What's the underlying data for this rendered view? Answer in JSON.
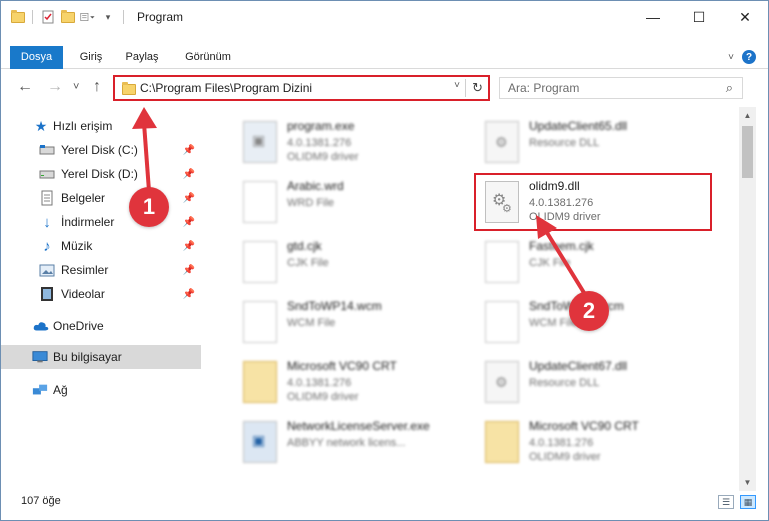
{
  "window": {
    "title": "Program",
    "minimize": "—",
    "maximize": "☐",
    "close": "✕"
  },
  "ribbon": {
    "tabs": [
      "Dosya",
      "Giriş",
      "Paylaş",
      "Görünüm"
    ],
    "help_label": "?"
  },
  "navigation": {
    "back": "←",
    "forward": "→",
    "recent": "˅",
    "up": "↑",
    "address_path": "C:\\Program Files\\Program Dizini",
    "search_placeholder": "Ara: Program"
  },
  "sidebar": {
    "items": [
      {
        "label": "Hızlı erişim",
        "icon": "star-icon"
      },
      {
        "label": "Yerel Disk (C:)",
        "icon": "drive-icon",
        "pinned": true
      },
      {
        "label": "Yerel Disk (D:)",
        "icon": "drive-icon",
        "pinned": true
      },
      {
        "label": "Belgeler",
        "icon": "documents-icon",
        "pinned": true
      },
      {
        "label": "İndirmeler",
        "icon": "downloads-icon",
        "pinned": true
      },
      {
        "label": "Müzik",
        "icon": "music-icon",
        "pinned": true
      },
      {
        "label": "Resimler",
        "icon": "pictures-icon",
        "pinned": true
      },
      {
        "label": "Videolar",
        "icon": "videos-icon",
        "pinned": true
      },
      {
        "label": "OneDrive",
        "icon": "cloud-icon"
      },
      {
        "label": "Bu bilgisayar",
        "icon": "computer-icon"
      },
      {
        "label": "Ağ",
        "icon": "network-icon"
      }
    ]
  },
  "files": [
    {
      "name": "program.exe",
      "line2": "4.0.1381.276",
      "line3": "OLIDM9 driver"
    },
    {
      "name": "UpdateClient65.dll",
      "line2": "Resource DLL",
      "line3": ""
    },
    {
      "name": "Arabic.wrd",
      "line2": "WRD File",
      "line3": ""
    },
    {
      "name": "olidm9.dll",
      "line2": "4.0.1381.276",
      "line3": "OLIDM9 driver"
    },
    {
      "name": "gtd.cjk",
      "line2": "CJK File",
      "line3": ""
    },
    {
      "name": "Fasteem.cjk",
      "line2": "CJK File",
      "line3": ""
    },
    {
      "name": "SndToWP14.wcm",
      "line2": "WCM File",
      "line3": ""
    },
    {
      "name": "SndToWP13.wcm",
      "line2": "WCM File",
      "line3": ""
    },
    {
      "name": "Microsoft VC90 CRT",
      "line2": "4.0.1381.276",
      "line3": "OLIDM9 driver"
    },
    {
      "name": "UpdateClient67.dll",
      "line2": "Resource DLL",
      "line3": ""
    },
    {
      "name": "NetworkLicenseServer.exe",
      "line2": "ABBYY network licens...",
      "line3": ""
    },
    {
      "name": "Microsoft VC90 CRT",
      "line2": "4.0.1381.276",
      "line3": "OLIDM9 driver"
    }
  ],
  "status": {
    "count": "107 öğe"
  },
  "annotations": {
    "step1": "1",
    "step2": "2",
    "color": "#e0343c"
  },
  "colors": {
    "accent": "#1979ca",
    "highlight": "#d9202a",
    "selection": "#cce8ff"
  }
}
